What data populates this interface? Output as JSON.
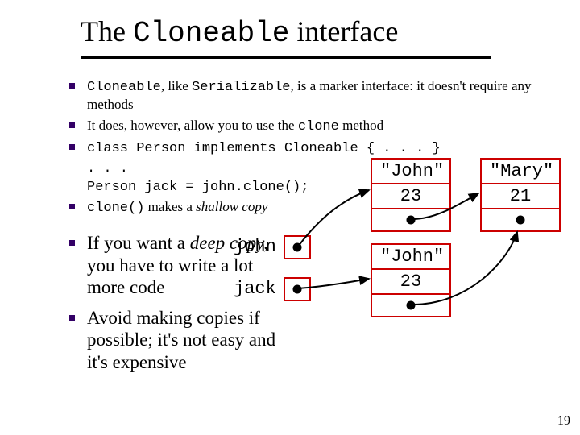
{
  "title": {
    "pre": "The ",
    "code": "Cloneable",
    "post": " interface"
  },
  "bullets": {
    "b1a": "Cloneable",
    "b1b": ", like ",
    "b1c": "Serializable",
    "b1d": ", is a marker interface: it doesn't require any methods",
    "b2a": "It does, however, allow you to use the ",
    "b2b": "clone",
    "b2c": " method",
    "b3": "class Person implements Cloneable { . . . }",
    "codeA": ". . .",
    "codeB": "Person jack = john.clone();",
    "b4a": "clone()",
    "b4b": " makes a ",
    "b4c": "shallow copy",
    "b5a": "If you want a ",
    "b5b": "deep copy,",
    "b5c": " you have to write a lot more code",
    "b6": "Avoid making copies if possible; it's not easy and it's expensive"
  },
  "diagram": {
    "johnLabel": "john",
    "jackLabel": "jack",
    "obj1": {
      "name": "\"John\"",
      "age": "23"
    },
    "obj2": {
      "name": "\"Mary\"",
      "age": "21"
    },
    "obj3": {
      "name": "\"John\"",
      "age": "23"
    }
  },
  "page": "19"
}
